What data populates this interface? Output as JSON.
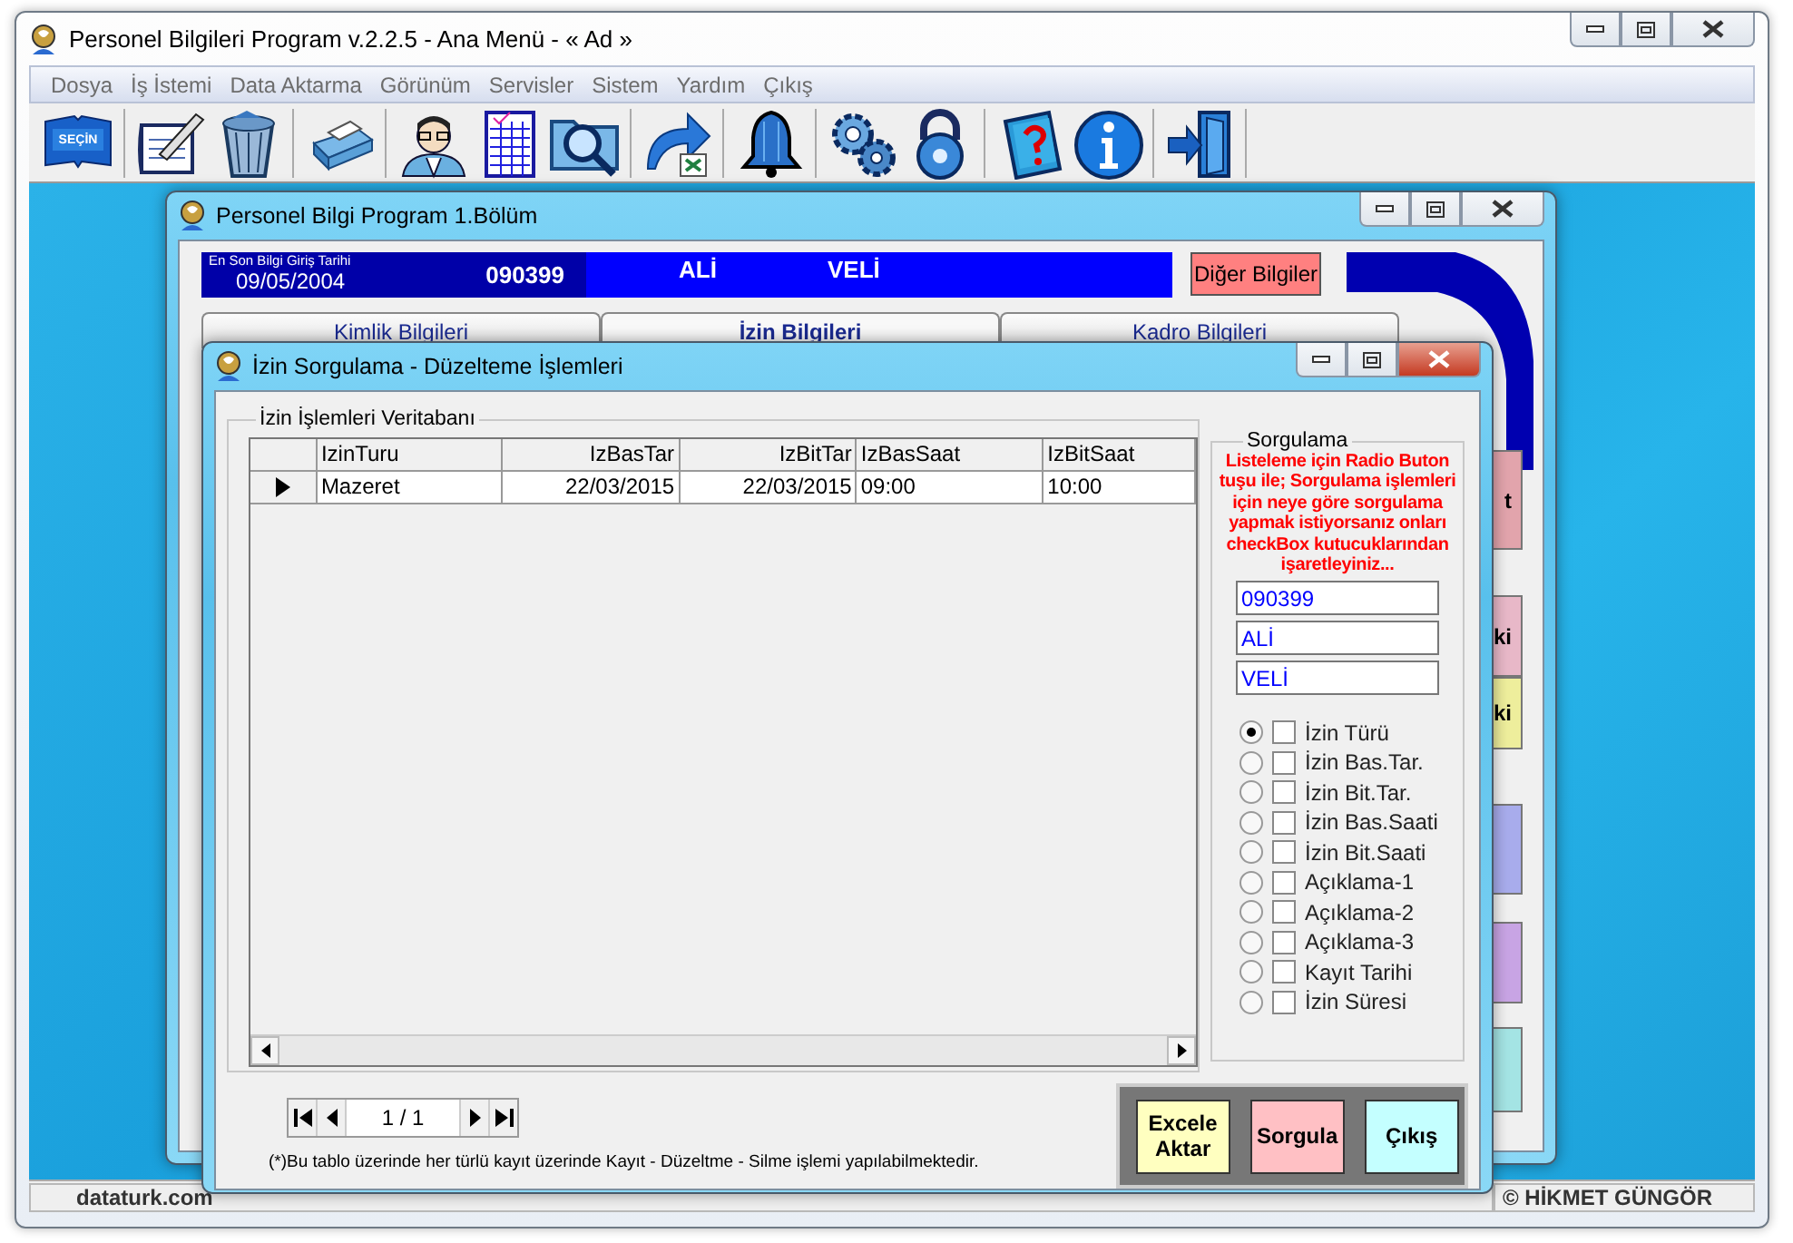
{
  "window": {
    "title": "Personel Bilgileri Program v.2.2.5  - Ana Menü -  « Ad »"
  },
  "menu": [
    "Dosya",
    "İş İstemi",
    "Data Aktarma",
    "Görünüm",
    "Servisler",
    "Sistem",
    "Yardım",
    "Çıkış"
  ],
  "toolbar": [
    {
      "kind": "book",
      "label": "SEÇİN"
    },
    {
      "kind": "sep"
    },
    {
      "kind": "notepad"
    },
    {
      "kind": "trash"
    },
    {
      "kind": "sep"
    },
    {
      "kind": "printer"
    },
    {
      "kind": "sep"
    },
    {
      "kind": "person"
    },
    {
      "kind": "sheet"
    },
    {
      "kind": "search"
    },
    {
      "kind": "sep"
    },
    {
      "kind": "arrow"
    },
    {
      "kind": "sep"
    },
    {
      "kind": "bell"
    },
    {
      "kind": "sep"
    },
    {
      "kind": "gears"
    },
    {
      "kind": "lock"
    },
    {
      "kind": "sep"
    },
    {
      "kind": "help"
    },
    {
      "kind": "info"
    },
    {
      "kind": "sep"
    },
    {
      "kind": "exit"
    },
    {
      "kind": "sep"
    }
  ],
  "child_window": {
    "title": "Personel Bilgi Program 1.Bölüm",
    "info": {
      "label": "En Son Bilgi Giriş Tarihi",
      "date": "09/05/2004",
      "number": "090399",
      "first_name": "ALİ",
      "last_name": "VELİ"
    },
    "button": "Diğer Bilgiler",
    "tabs": [
      {
        "label": "Kimlik Bilgileri",
        "selected": false
      },
      {
        "label": "İzin Bilgileri",
        "selected": true
      },
      {
        "label": "Kadro Bilgileri",
        "selected": false
      }
    ],
    "side_buttons": [
      {
        "label": "t",
        "color": "#e2a4ac"
      },
      {
        "label": "ki",
        "color": "#e8b8c8"
      },
      {
        "label": "ki",
        "color": "#eeee9c"
      },
      {
        "color": "#a8acec"
      },
      {
        "color": "#c8a4e4"
      },
      {
        "color": "#a4e4e4"
      }
    ]
  },
  "dialog": {
    "title": "İzin Sorgulama - Düzelteme İşlemleri",
    "group": "İzin İşlemleri Veritabanı",
    "table": {
      "columns": [
        "IzinTuru",
        "IzBasTar",
        "IzBitTar",
        "IzBasSaat",
        "IzBitSaat"
      ],
      "rows": [
        {
          "cells": [
            "Mazeret",
            "22/03/2015",
            "22/03/2015",
            "09:00",
            "10:00"
          ],
          "selected": true
        }
      ]
    },
    "navigator": "1 / 1",
    "note": "(*)Bu tablo üzerinde her türlü kayıt üzerinde Kayıt - Düzeltme - Silme işlemi yapılabilmektedir.",
    "query": {
      "title": "Sorgulama",
      "hint": "Listeleme için Radio Buton tuşu ile; Sorgulama işlemleri için neye göre sorgulama yapmak istiyorsanız onları  checkBox kutucuklarından işaretleyiniz...",
      "fields": [
        {
          "value": "090399"
        },
        {
          "value": "ALİ"
        },
        {
          "value": "VELİ"
        }
      ],
      "options": [
        {
          "label": "İzin Türü",
          "selected": true,
          "checked": false
        },
        {
          "label": "İzin Bas.Tar.",
          "selected": false,
          "checked": false
        },
        {
          "label": "İzin Bit.Tar.",
          "selected": false,
          "checked": false
        },
        {
          "label": "İzin Bas.Saati",
          "selected": false,
          "checked": false
        },
        {
          "label": "İzin Bit.Saati",
          "selected": false,
          "checked": false
        },
        {
          "label": "Açıklama-1",
          "selected": false,
          "checked": false
        },
        {
          "label": "Açıklama-2",
          "selected": false,
          "checked": false
        },
        {
          "label": "Açıklama-3",
          "selected": false,
          "checked": false
        },
        {
          "label": "Kayıt Tarihi",
          "selected": false,
          "checked": false
        },
        {
          "label": "İzin Süresi",
          "selected": false,
          "checked": false
        }
      ]
    },
    "buttons": [
      {
        "label": "Excele Aktar",
        "color": "#ffffc0"
      },
      {
        "label": "Sorgula",
        "color": "#ffc0c4"
      },
      {
        "label": "Çıkış",
        "color": "#c4ffff"
      }
    ]
  },
  "status_bar": [
    "dataturk.com",
    "© HİKMET GÜNGÖR"
  ]
}
